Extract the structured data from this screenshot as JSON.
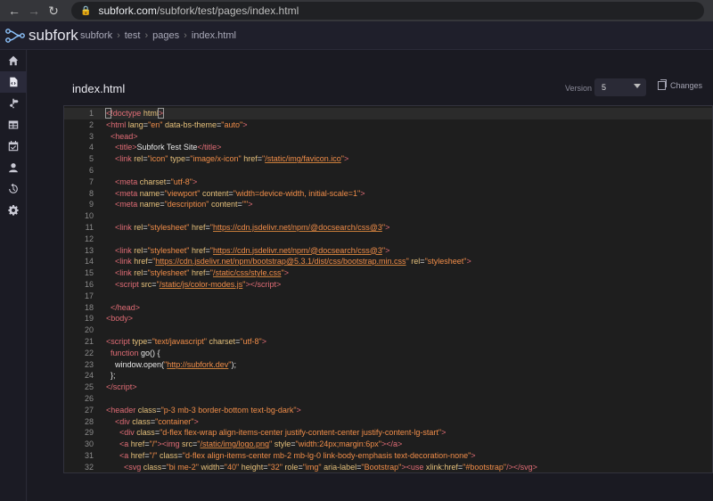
{
  "browser": {
    "back_icon": "arrow-left-icon",
    "forward_icon": "arrow-right-icon",
    "reload_icon": "reload-icon",
    "url_host": "subfork.com",
    "url_path": "/subfork/test/pages/index.html"
  },
  "app": {
    "logo_text": "subfork",
    "breadcrumbs": [
      "subfork",
      "test",
      "pages",
      "index.html"
    ]
  },
  "sidebar": {
    "items": [
      {
        "icon": "home-icon"
      },
      {
        "icon": "file-code-icon",
        "active": true
      },
      {
        "icon": "signpost-icon"
      },
      {
        "icon": "table-icon"
      },
      {
        "icon": "calendar-icon"
      },
      {
        "icon": "user-icon"
      },
      {
        "icon": "history-icon"
      },
      {
        "icon": "gear-icon"
      }
    ]
  },
  "page": {
    "title": "index.html",
    "version_label": "Version",
    "version_value": "5",
    "changes_label": "Changes"
  },
  "editor": {
    "lines": [
      {
        "n": "1",
        "html": "<span class=\"t cursorbox\">&lt;</span><span class=\"t\">!doctype</span> <span class=\"a\">html</span><span class=\"t cursorbox\">&gt;</span>",
        "cur": true
      },
      {
        "n": "2",
        "html": "<span class=\"t\">&lt;html</span> <span class=\"a\">lang</span>=<span class=\"v\">\"en\"</span> <span class=\"a\">data-bs-theme</span>=<span class=\"v\">\"auto\"</span><span class=\"t\">&gt;</span>"
      },
      {
        "n": "3",
        "html": "  <span class=\"t\">&lt;head&gt;</span>"
      },
      {
        "n": "4",
        "html": "    <span class=\"t\">&lt;title&gt;</span>Subfork Test Site<span class=\"t\">&lt;/title&gt;</span>"
      },
      {
        "n": "5",
        "html": "    <span class=\"t\">&lt;link</span> <span class=\"a\">rel</span>=<span class=\"v\">\"icon\"</span> <span class=\"a\">type</span>=<span class=\"v\">\"image/x-icon\"</span> <span class=\"a\">href</span>=<span class=\"v\">\"<span class=\"u\">/static/img/favicon.ico</span>\"</span><span class=\"t\">&gt;</span>"
      },
      {
        "n": "6",
        "html": ""
      },
      {
        "n": "7",
        "html": "    <span class=\"t\">&lt;meta</span> <span class=\"a\">charset</span>=<span class=\"v\">\"utf-8\"</span><span class=\"t\">&gt;</span>"
      },
      {
        "n": "8",
        "html": "    <span class=\"t\">&lt;meta</span> <span class=\"a\">name</span>=<span class=\"v\">\"viewport\"</span> <span class=\"a\">content</span>=<span class=\"v\">\"width=device-width, initial-scale=1\"</span><span class=\"t\">&gt;</span>"
      },
      {
        "n": "9",
        "html": "    <span class=\"t\">&lt;meta</span> <span class=\"a\">name</span>=<span class=\"v\">\"description\"</span> <span class=\"a\">content</span>=<span class=\"v\">\"\"</span><span class=\"t\">&gt;</span>"
      },
      {
        "n": "10",
        "html": ""
      },
      {
        "n": "11",
        "html": "    <span class=\"t\">&lt;link</span> <span class=\"a\">rel</span>=<span class=\"v\">\"stylesheet\"</span> <span class=\"a\">href</span>=<span class=\"v\">\"<span class=\"u\">https://cdn.jsdelivr.net/npm/@docsearch/css@3</span>\"</span><span class=\"t\">&gt;</span>"
      },
      {
        "n": "12",
        "html": ""
      },
      {
        "n": "13",
        "html": "    <span class=\"t\">&lt;link</span> <span class=\"a\">rel</span>=<span class=\"v\">\"stylesheet\"</span> <span class=\"a\">href</span>=<span class=\"v\">\"<span class=\"u\">https://cdn.jsdelivr.net/npm/@docsearch/css@3</span>\"</span><span class=\"t\">&gt;</span>"
      },
      {
        "n": "14",
        "html": "    <span class=\"t\">&lt;link</span> <span class=\"a\">href</span>=<span class=\"v\">\"<span class=\"u\">https://cdn.jsdelivr.net/npm/bootstrap@5.3.1/dist/css/bootstrap.min.css</span>\"</span> <span class=\"a\">rel</span>=<span class=\"v\">\"stylesheet\"</span><span class=\"t\">&gt;</span>"
      },
      {
        "n": "15",
        "html": "    <span class=\"t\">&lt;link</span> <span class=\"a\">rel</span>=<span class=\"v\">\"stylesheet\"</span> <span class=\"a\">href</span>=<span class=\"v\">\"<span class=\"u\">/static/css/style.css</span>\"</span><span class=\"t\">&gt;</span>"
      },
      {
        "n": "16",
        "html": "    <span class=\"t\">&lt;script</span> <span class=\"a\">src</span>=<span class=\"v\">\"<span class=\"u\">/static/js/color-modes.js</span>\"</span><span class=\"t\">&gt;&lt;/script&gt;</span>"
      },
      {
        "n": "17",
        "html": ""
      },
      {
        "n": "18",
        "html": "  <span class=\"t\">&lt;/head&gt;</span>"
      },
      {
        "n": "19",
        "html": "<span class=\"t\">&lt;body&gt;</span>"
      },
      {
        "n": "20",
        "html": ""
      },
      {
        "n": "21",
        "html": "<span class=\"t\">&lt;script</span> <span class=\"a\">type</span>=<span class=\"v\">\"text/javascript\"</span> <span class=\"a\">charset</span>=<span class=\"v\">\"utf-8\"</span><span class=\"t\">&gt;</span>"
      },
      {
        "n": "22",
        "html": "  <span class=\"t\">function</span> go() {"
      },
      {
        "n": "23",
        "html": "    window.open(<span class=\"v\">\"<span class=\"u\">http://subfork.dev</span>\"</span>);"
      },
      {
        "n": "24",
        "html": "  };"
      },
      {
        "n": "25",
        "html": "<span class=\"t\">&lt;/script&gt;</span>"
      },
      {
        "n": "26",
        "html": ""
      },
      {
        "n": "27",
        "html": "<span class=\"t\">&lt;header</span> <span class=\"a\">class</span>=<span class=\"v\">\"p-3 mb-3 border-bottom text-bg-dark\"</span><span class=\"t\">&gt;</span>"
      },
      {
        "n": "28",
        "html": "    <span class=\"t\">&lt;div</span> <span class=\"a\">class</span>=<span class=\"v\">\"container\"</span><span class=\"t\">&gt;</span>"
      },
      {
        "n": "29",
        "html": "      <span class=\"t\">&lt;div</span> <span class=\"a\">class</span>=<span class=\"v\">\"d-flex flex-wrap align-items-center justify-content-center justify-content-lg-start\"</span><span class=\"t\">&gt;</span>"
      },
      {
        "n": "30",
        "html": "      <span class=\"t\">&lt;a</span> <span class=\"a\">href</span>=<span class=\"v\">\"/\"</span><span class=\"t\">&gt;&lt;img</span> <span class=\"a\">src</span>=<span class=\"v\">\"<span class=\"u\">/static/img/logo.png</span>\"</span> <span class=\"a\">style</span>=<span class=\"v\">\"width:24px;margin:6px\"</span><span class=\"t\">&gt;&lt;/a&gt;</span>"
      },
      {
        "n": "31",
        "html": "      <span class=\"t\">&lt;a</span> <span class=\"a\">href</span>=<span class=\"v\">\"/\"</span> <span class=\"a\">class</span>=<span class=\"v\">\"d-flex align-items-center mb-2 mb-lg-0 link-body-emphasis text-decoration-none\"</span><span class=\"t\">&gt;</span>"
      },
      {
        "n": "32",
        "html": "        <span class=\"t\">&lt;svg</span> <span class=\"a\">class</span>=<span class=\"v\">\"bi me-2\"</span> <span class=\"a\">width</span>=<span class=\"v\">\"40\"</span> <span class=\"a\">height</span>=<span class=\"v\">\"32\"</span> <span class=\"a\">role</span>=<span class=\"v\">\"img\"</span> <span class=\"a\">aria-label</span>=<span class=\"v\">\"Bootstrap\"</span><span class=\"t\">&gt;&lt;use</span> <span class=\"a\">xlink:href</span>=<span class=\"v\">\"#bootstrap\"</span><span class=\"t\">/&gt;&lt;/svg&gt;</span>"
      }
    ]
  }
}
